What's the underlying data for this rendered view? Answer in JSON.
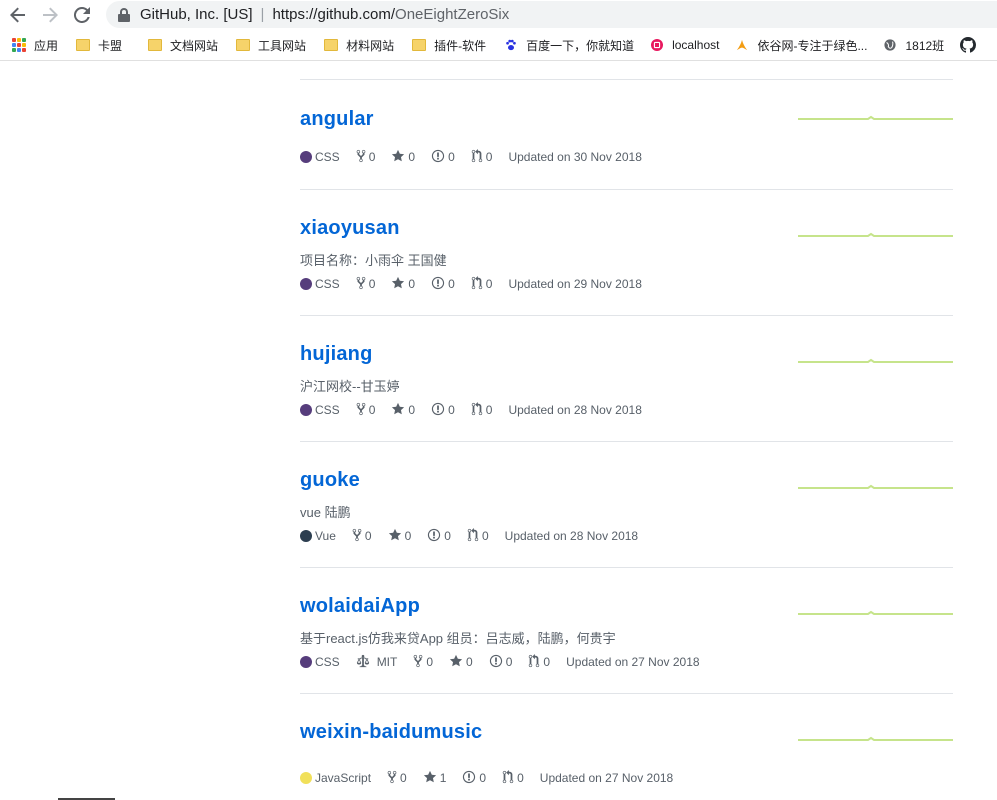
{
  "browser": {
    "org": "GitHub, Inc. [US]",
    "url_host": "https://github.com/",
    "url_path": "OneEightZeroSix",
    "bookmarks": [
      {
        "label": "应用",
        "icon": "apps-icon"
      },
      {
        "label": "卡盟",
        "icon": "folder-icon"
      },
      {
        "label": "文档网站",
        "icon": "folder-icon"
      },
      {
        "label": "工具网站",
        "icon": "folder-icon"
      },
      {
        "label": "材料网站",
        "icon": "folder-icon"
      },
      {
        "label": "插件-软件",
        "icon": "folder-icon"
      },
      {
        "label": "百度一下，你就知道",
        "icon": "baidu-paw-icon"
      },
      {
        "label": "localhost",
        "icon": "localhost-icon"
      },
      {
        "label": "依谷网-专注于绿色...",
        "icon": "yigu-icon"
      },
      {
        "label": "1812班",
        "icon": "globe-icon"
      },
      {
        "label": "",
        "icon": "github-icon"
      }
    ]
  },
  "repos": [
    {
      "name": "angular",
      "description": "",
      "language": "CSS",
      "language_color": "#563d7c",
      "license": "",
      "forks": "0",
      "stars": "0",
      "issues": "0",
      "prs": "0",
      "updated": "Updated on 30 Nov 2018"
    },
    {
      "name": "xiaoyusan",
      "description": "项目名称：小雨伞 王国健",
      "language": "CSS",
      "language_color": "#563d7c",
      "license": "",
      "forks": "0",
      "stars": "0",
      "issues": "0",
      "prs": "0",
      "updated": "Updated on 29 Nov 2018"
    },
    {
      "name": "hujiang",
      "description": "沪江网校--甘玉婷",
      "language": "CSS",
      "language_color": "#563d7c",
      "license": "",
      "forks": "0",
      "stars": "0",
      "issues": "0",
      "prs": "0",
      "updated": "Updated on 28 Nov 2018"
    },
    {
      "name": "guoke",
      "description": "vue 陆鹏",
      "language": "Vue",
      "language_color": "#2c3e50",
      "license": "",
      "forks": "0",
      "stars": "0",
      "issues": "0",
      "prs": "0",
      "updated": "Updated on 28 Nov 2018"
    },
    {
      "name": "wolaidaiApp",
      "description": "基于react.js仿我来贷App 组员：吕志威，陆鹏，何贵宇",
      "language": "CSS",
      "language_color": "#563d7c",
      "license": "MIT",
      "forks": "0",
      "stars": "0",
      "issues": "0",
      "prs": "0",
      "updated": "Updated on 27 Nov 2018"
    },
    {
      "name": "weixin-baidumusic",
      "description": "",
      "language": "JavaScript",
      "language_color": "#f1e05a",
      "license": "",
      "forks": "0",
      "stars": "1",
      "issues": "0",
      "prs": "0",
      "updated": "Updated on 27 Nov 2018"
    }
  ],
  "colors": {
    "link": "#0366d6",
    "sparkline": "#c6e48b",
    "muted": "#586069"
  }
}
